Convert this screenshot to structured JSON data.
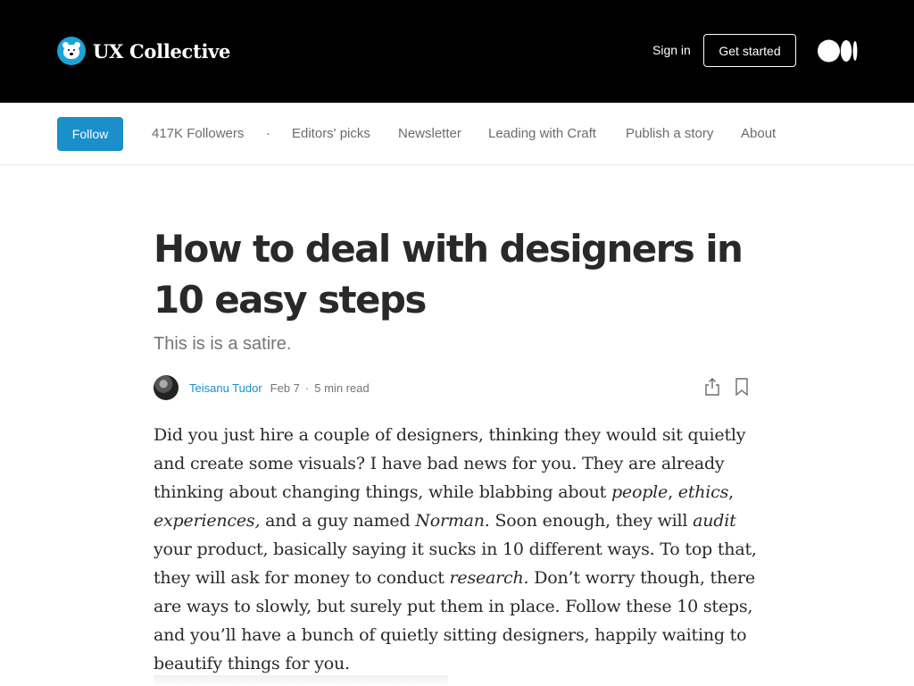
{
  "header": {
    "brand": "UX Collective",
    "sign_in": "Sign in",
    "get_started": "Get started"
  },
  "subnav": {
    "follow": "Follow",
    "followers": "417K Followers",
    "separator": "·",
    "items": [
      "Editors' picks",
      "Newsletter",
      "Leading with Craft",
      "Publish a story",
      "About"
    ]
  },
  "article": {
    "title": "How to deal with designers in 10 easy steps",
    "subtitle": "This is is a satire.",
    "author": "Teisanu Tudor",
    "date": "Feb 7",
    "separator": "·",
    "read_time": "5 min read",
    "paragraph": {
      "p1": "Did you just hire a couple of designers, thinking they would sit quietly and create some visuals? I have bad news for you. They are already thinking about changing things, while blabbing about ",
      "i1": "people",
      "p2": ", ",
      "i2": "ethics",
      "p3": ", ",
      "i3": "experiences,",
      "p4": " and a guy named ",
      "i4": "Norman.",
      "p5": " Soon enough, they will ",
      "i5": "audit",
      "p6": " your product, basically saying it sucks in 10 different ways. To top that, they will ask for money to conduct ",
      "i6": "research.",
      "p7": " Don’t worry though, there are ways to slowly, but surely put them in place. Follow these 10 steps, and you’ll have a bunch of quietly sitting designers, happily waiting to beautify things for you."
    }
  },
  "colors": {
    "header_bg": "#000000",
    "accent": "#1a8fc9",
    "text": "#292929",
    "muted": "#757575"
  }
}
